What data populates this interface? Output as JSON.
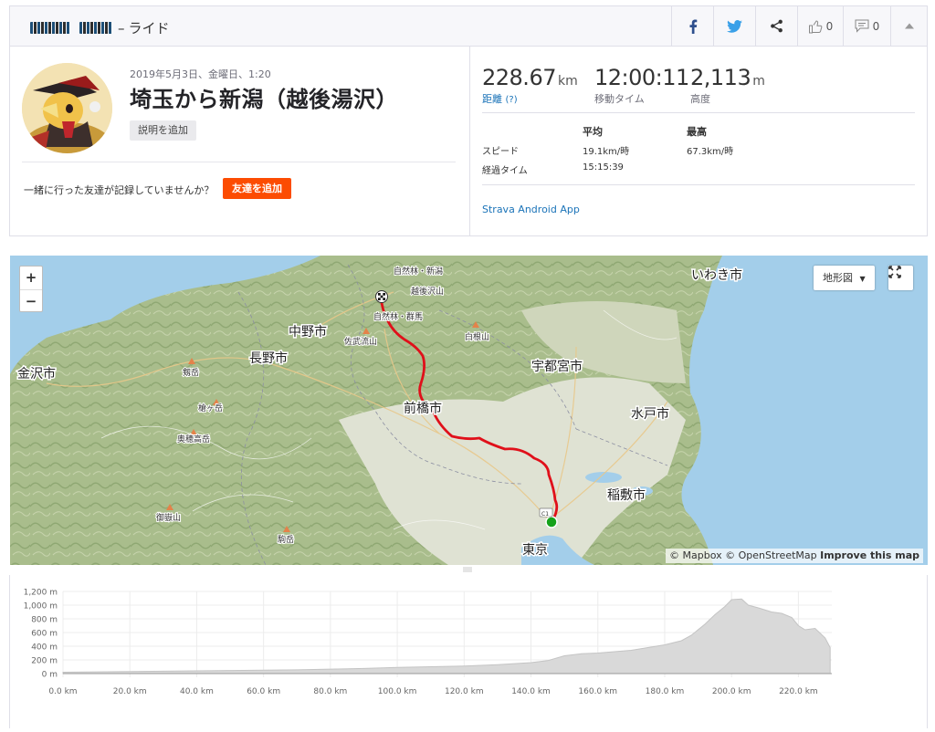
{
  "header": {
    "athlete_name_redacted": "■■■ ■■■",
    "separator": "–",
    "activity_type": "ライド",
    "kudos_count": "0",
    "comment_count": "0"
  },
  "activity": {
    "date": "2019年5月3日、金曜日、1:20",
    "title": "埼玉から新潟（越後湯沢）",
    "add_description": "説明を追加",
    "friends_question": "一緒に行った友達が記録していませんか？",
    "add_friends": "友達を追加"
  },
  "stats": {
    "distance": {
      "value": "228.67",
      "unit": "km",
      "label": "距離",
      "help": "(?)"
    },
    "moving_time": {
      "value": "12:00:11",
      "label": "移動タイム"
    },
    "elevation": {
      "value": "2,113",
      "unit": "m",
      "label": "高度"
    },
    "table": {
      "col_avg": "平均",
      "col_max": "最高",
      "rows": [
        {
          "label": "スピード",
          "avg": "19.1km/時",
          "max": "67.3km/時"
        },
        {
          "label": "経過タイム",
          "avg": "15:15:39",
          "max": ""
        }
      ]
    },
    "device": "Strava Android App"
  },
  "map": {
    "zoom_in": "+",
    "zoom_out": "−",
    "map_type": "地形図",
    "attribution_mapbox": "© Mapbox",
    "attribution_osm": "© OpenStreetMap",
    "attribution_improve": "Improve this map",
    "labels": [
      {
        "text": "いわき市",
        "size": "big"
      },
      {
        "text": "中野市",
        "size": "big"
      },
      {
        "text": "長野市",
        "size": "big"
      },
      {
        "text": "金沢市",
        "size": "big"
      },
      {
        "text": "宇都宮市",
        "size": "big"
      },
      {
        "text": "前橋市",
        "size": "big"
      },
      {
        "text": "水戸市",
        "size": "big"
      },
      {
        "text": "稲敷市",
        "size": "big"
      },
      {
        "text": "東京",
        "size": "big"
      },
      {
        "text": "自然林・新潟",
        "size": "small"
      },
      {
        "text": "越後沢山",
        "size": "small"
      },
      {
        "text": "自然林・群馬",
        "size": "small"
      },
      {
        "text": "佐武流山",
        "size": "small"
      },
      {
        "text": "白根山",
        "size": "small"
      },
      {
        "text": "剱岳",
        "size": "small"
      },
      {
        "text": "槍ヶ岳",
        "size": "small"
      },
      {
        "text": "奥穂高岳",
        "size": "small"
      },
      {
        "text": "御嶽山",
        "size": "small"
      },
      {
        "text": "駒岳",
        "size": "small"
      },
      {
        "text": "C1",
        "size": "small"
      }
    ]
  },
  "chart_data": {
    "type": "area",
    "title": "",
    "xlabel": "",
    "ylabel": "",
    "xlim": [
      0,
      230
    ],
    "ylim": [
      0,
      1200
    ],
    "x_ticks": [
      "0.0 km",
      "20.0 km",
      "40.0 km",
      "60.0 km",
      "80.0 km",
      "100.0 km",
      "120.0 km",
      "140.0 km",
      "160.0 km",
      "180.0 km",
      "200.0 km",
      "220.0 km"
    ],
    "y_ticks": [
      "0 m",
      "200 m",
      "400 m",
      "600 m",
      "800 m",
      "1,000 m",
      "1,200 m"
    ],
    "grid": true,
    "series": [
      {
        "x": [
          0,
          10,
          20,
          30,
          40,
          50,
          60,
          70,
          80,
          90,
          100,
          110,
          120,
          130,
          140,
          145,
          150,
          155,
          160,
          165,
          170,
          175,
          180,
          185,
          188,
          192,
          195,
          198,
          200,
          203,
          205,
          208,
          212,
          215,
          218,
          220,
          222,
          225,
          228,
          229.5
        ],
        "y": [
          20,
          25,
          30,
          35,
          40,
          45,
          50,
          55,
          65,
          75,
          90,
          100,
          110,
          130,
          160,
          190,
          260,
          290,
          300,
          320,
          340,
          380,
          420,
          480,
          560,
          720,
          860,
          980,
          1080,
          1090,
          1000,
          960,
          900,
          880,
          820,
          700,
          640,
          660,
          520,
          380
        ]
      }
    ]
  },
  "colors": {
    "brand": "#fc4c02",
    "link": "#1a73b8",
    "route": "#e0101a",
    "start_marker": "#16a21b"
  }
}
